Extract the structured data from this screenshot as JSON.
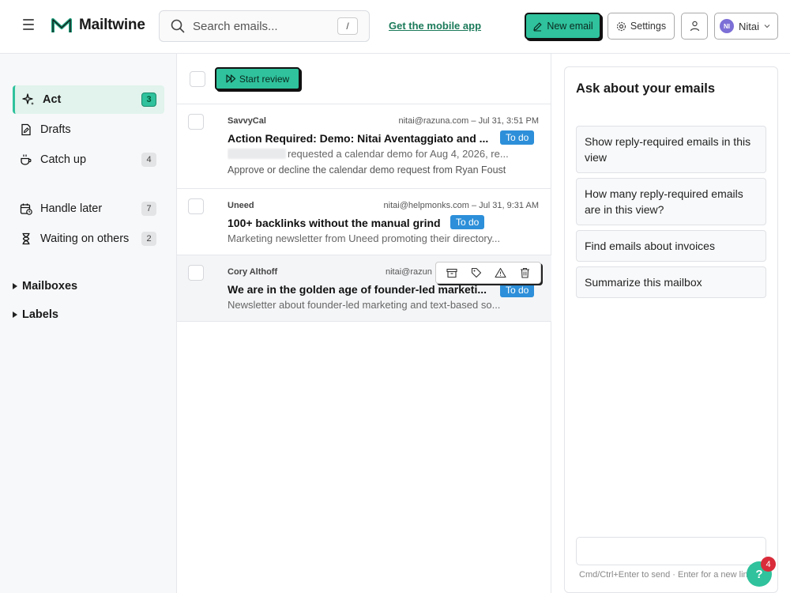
{
  "header": {
    "app_name": "Mailtwine",
    "search_placeholder": "Search emails...",
    "search_shortcut": "/",
    "mobile_link": "Get the mobile app",
    "new_email_label": "New email",
    "settings_label": "Settings",
    "account_initials": "NI",
    "account_name": "Nitai"
  },
  "sidebar": {
    "items": [
      {
        "label": "Act",
        "count": "3",
        "icon": "sparkle-icon"
      },
      {
        "label": "Drafts",
        "icon": "draft-icon"
      },
      {
        "label": "Catch up",
        "count": "4",
        "icon": "coffee-icon"
      },
      {
        "label": "Handle later",
        "count": "7",
        "icon": "calendar-clock-icon"
      },
      {
        "label": "Waiting on others",
        "count": "2",
        "icon": "hourglass-icon"
      }
    ],
    "sections": [
      "Mailboxes",
      "Labels"
    ]
  },
  "list": {
    "review_label": "Start review",
    "emails": [
      {
        "sender": "SavvyCal",
        "to": "nitai@razuna.com",
        "date": "Jul 31, 3:51 PM",
        "subject": "Action Required: Demo: Nitai Aventaggiato and ...",
        "badge": "To do",
        "snippet": "requested a calendar demo for Aug 4, 2026, re...",
        "summary": "Approve or decline the calendar demo request from Ryan Foust"
      },
      {
        "sender": "Uneed",
        "to": "nitai@helpmonks.com",
        "date": "Jul 31, 9:31 AM",
        "subject": "100+ backlinks without the manual grind",
        "badge": "To do",
        "snippet": "Marketing newsletter from Uneed promoting their directory..."
      },
      {
        "sender": "Cory Althoff",
        "to": "nitai@razun",
        "subject": "We are in the golden age of founder-led marketi...",
        "badge": "To do",
        "snippet": "Newsletter about founder-led marketing and text-based so..."
      }
    ]
  },
  "assistant": {
    "title": "Ask about your emails",
    "suggestions": [
      "Show reply-required emails in this view",
      "How many reply-required emails are in this view?",
      "Find emails about invoices",
      "Summarize this mailbox"
    ],
    "hint": "Cmd/Ctrl+Enter to send · Enter for a new line"
  },
  "help": {
    "label": "?",
    "count": "4"
  },
  "colors": {
    "accent": "#2fc29c",
    "badge": "#2d8fd9",
    "link": "#1b7a5a",
    "notification": "#d92b3a"
  }
}
